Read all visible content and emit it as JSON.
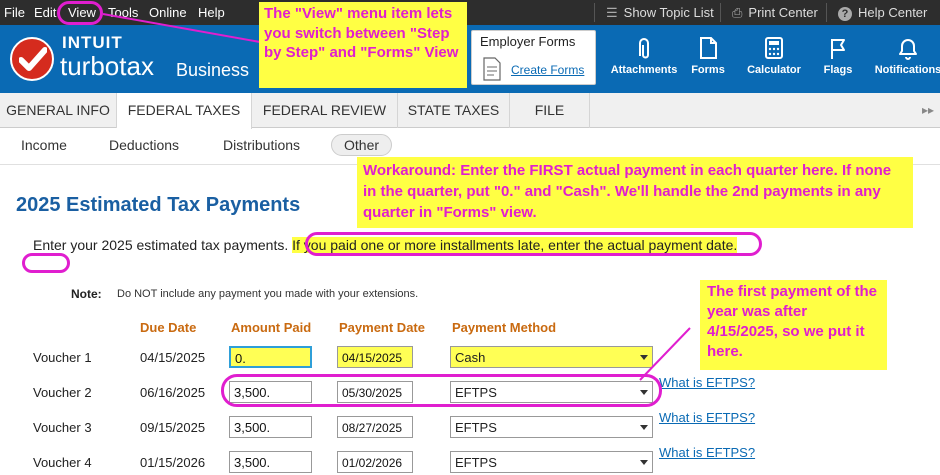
{
  "menubar": {
    "items": [
      "File",
      "Edit",
      "View",
      "Tools",
      "Online",
      "Help"
    ],
    "show_topic_list": "Show Topic List",
    "print_center": "Print Center",
    "help_center": "Help Center"
  },
  "header": {
    "brand_intuit": "INTUIT",
    "brand_turbotax": "turbotax",
    "brand_business": "Business",
    "employer_forms_title": "Employer Forms",
    "create_forms_link": "Create Forms",
    "tools": [
      "Attachments",
      "Forms",
      "Calculator",
      "Flags",
      "Notifications"
    ]
  },
  "tabs": [
    "GENERAL INFO",
    "FEDERAL TAXES",
    "FEDERAL REVIEW",
    "STATE TAXES",
    "FILE"
  ],
  "active_tab": "FEDERAL TAXES",
  "subtabs": [
    "Income",
    "Deductions",
    "Distributions",
    "Other"
  ],
  "active_subtab": "Other",
  "page": {
    "title": "2025 Estimated Tax Payments",
    "intro_plain": "Enter your 2025 estimated tax payments. ",
    "intro_highlight": "If you paid one or more installments late, enter the actual payment date.",
    "note_label": "Note:",
    "note_text": "Do NOT include any payment you made with your extensions."
  },
  "table": {
    "headers": [
      "Due Date",
      "Amount Paid",
      "Payment Date",
      "Payment Method"
    ],
    "rows": [
      {
        "voucher": "Voucher 1",
        "due": "04/15/2025",
        "amount": "0.",
        "date": "04/15/2025",
        "method": "Cash",
        "help": ""
      },
      {
        "voucher": "Voucher 2",
        "due": "06/16/2025",
        "amount": "3,500.",
        "date": "05/30/2025",
        "method": "EFTPS",
        "help": "What is EFTPS?"
      },
      {
        "voucher": "Voucher 3",
        "due": "09/15/2025",
        "amount": "3,500.",
        "date": "08/27/2025",
        "method": "EFTPS",
        "help": "What is EFTPS?"
      },
      {
        "voucher": "Voucher 4",
        "due": "01/15/2026",
        "amount": "3,500.",
        "date": "01/02/2026",
        "method": "EFTPS",
        "help": "What is EFTPS?"
      }
    ]
  },
  "annotations": {
    "view_menu": "The \"View\" menu item lets you switch between \"Step by Step\" and \"Forms\" View",
    "workaround": "Workaround: Enter the FIRST actual payment in each quarter here. If none in the quarter, put \"0.\" and \"Cash\". We'll handle the 2nd payments in any quarter in \"Forms\" view.",
    "first_payment": "The first payment of the year was after 4/15/2025, so we put it here."
  },
  "colors": {
    "annotation_magenta": "#e01ecf",
    "annotation_yellow": "#ffff44",
    "header_blue": "#0a6ab4",
    "title_blue": "#1a5fa2",
    "column_orange": "#c96a10"
  }
}
